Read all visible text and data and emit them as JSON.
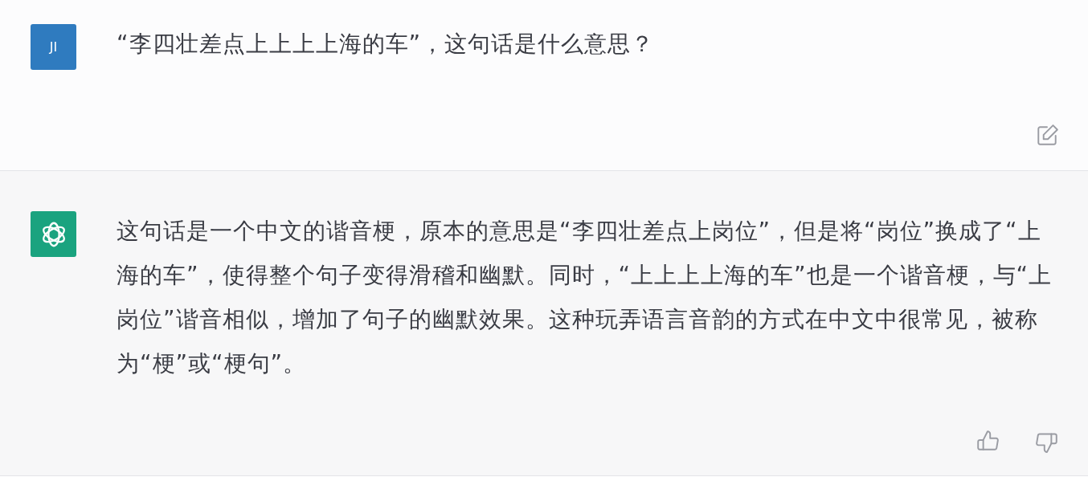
{
  "messages": [
    {
      "kind": "user",
      "avatar": "JI",
      "text": "“李四壮差点上上上上海的车”，这句话是什么意思？",
      "actions": [
        {
          "kind": "edit"
        }
      ]
    },
    {
      "kind": "assistant",
      "text": "这句话是一个中文的谐音梗，原本的意思是“李四壮差点上岗位”，但是将“岗位”换成了“上海的车”，使得整个句子变得滑稽和幽默。同时，“上上上上海的车”也是一个谐音梗，与“上岗位”谐音相似，增加了句子的幽默效果。这种玩弄语言音韵的方式在中文中很常见，被称为“梗”或“梗句”。",
      "actions": [
        {
          "kind": "thumbs-up"
        },
        {
          "kind": "thumbs-down"
        }
      ]
    }
  ]
}
